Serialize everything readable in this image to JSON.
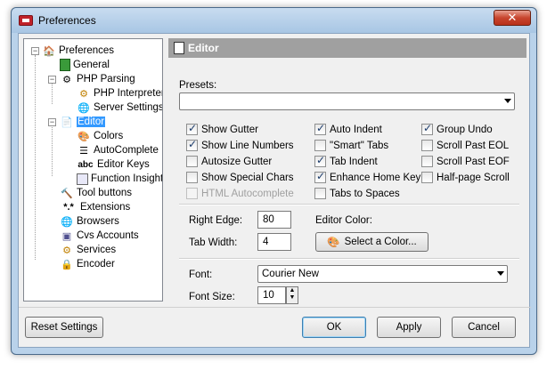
{
  "window": {
    "title": "Preferences",
    "close_glyph": "✕"
  },
  "tree": {
    "items": [
      {
        "label": "Preferences",
        "icon": "house-icon"
      },
      {
        "label": "General",
        "icon": "page-icon"
      },
      {
        "label": "PHP Parsing",
        "icon": "gears-icon"
      },
      {
        "label": "PHP Interpreter",
        "icon": "gear-icon"
      },
      {
        "label": "Server Settings",
        "icon": "globe-icon"
      },
      {
        "label": "Editor",
        "icon": "document-icon"
      },
      {
        "label": "Colors",
        "icon": "colors-icon"
      },
      {
        "label": "AutoComplete",
        "icon": "list-icon"
      },
      {
        "label": "Editor Keys",
        "icon": "abc-icon",
        "glyph": "abc"
      },
      {
        "label": "Function Insight",
        "icon": "function-icon"
      },
      {
        "label": "Tool buttons",
        "icon": "hammer-icon"
      },
      {
        "label": "Extensions",
        "icon": "extensions-icon",
        "glyph": "*.*"
      },
      {
        "label": "Browsers",
        "icon": "browser-icon"
      },
      {
        "label": "Cvs Accounts",
        "icon": "cvs-icon"
      },
      {
        "label": "Services",
        "icon": "services-icon"
      },
      {
        "label": "Encoder",
        "icon": "lock-icon"
      }
    ]
  },
  "panel": {
    "title": "Editor",
    "presets_label": "Presets:",
    "presets_value": "",
    "checkboxes": [
      {
        "label": "Show Gutter",
        "checked": true,
        "disabled": false
      },
      {
        "label": "Show Line Numbers",
        "checked": true,
        "disabled": false
      },
      {
        "label": "Autosize Gutter",
        "checked": false,
        "disabled": false
      },
      {
        "label": "Show Special Chars",
        "checked": false,
        "disabled": false
      },
      {
        "label": "HTML Autocomplete",
        "checked": false,
        "disabled": true
      },
      {
        "label": "Auto Indent",
        "checked": true,
        "disabled": false
      },
      {
        "label": "\"Smart\" Tabs",
        "checked": false,
        "disabled": false
      },
      {
        "label": "Tab Indent",
        "checked": true,
        "disabled": false
      },
      {
        "label": "Enhance Home Key",
        "checked": true,
        "disabled": false
      },
      {
        "label": "Tabs to Spaces",
        "checked": false,
        "disabled": false
      },
      {
        "label": "Group Undo",
        "checked": true,
        "disabled": false
      },
      {
        "label": "Scroll Past EOL",
        "checked": false,
        "disabled": false
      },
      {
        "label": "Scroll Past EOF",
        "checked": false,
        "disabled": false
      },
      {
        "label": "Half-page Scroll",
        "checked": false,
        "disabled": false
      }
    ],
    "right_edge_label": "Right Edge:",
    "right_edge_value": "80",
    "tab_width_label": "Tab Width:",
    "tab_width_value": "4",
    "editor_color_label": "Editor Color:",
    "select_color_label": "Select a Color...",
    "font_label": "Font:",
    "font_value": "Courier New",
    "font_size_label": "Font Size:",
    "font_size_value": "10"
  },
  "buttons": {
    "reset": "Reset Settings",
    "ok": "OK",
    "apply": "Apply",
    "cancel": "Cancel"
  }
}
